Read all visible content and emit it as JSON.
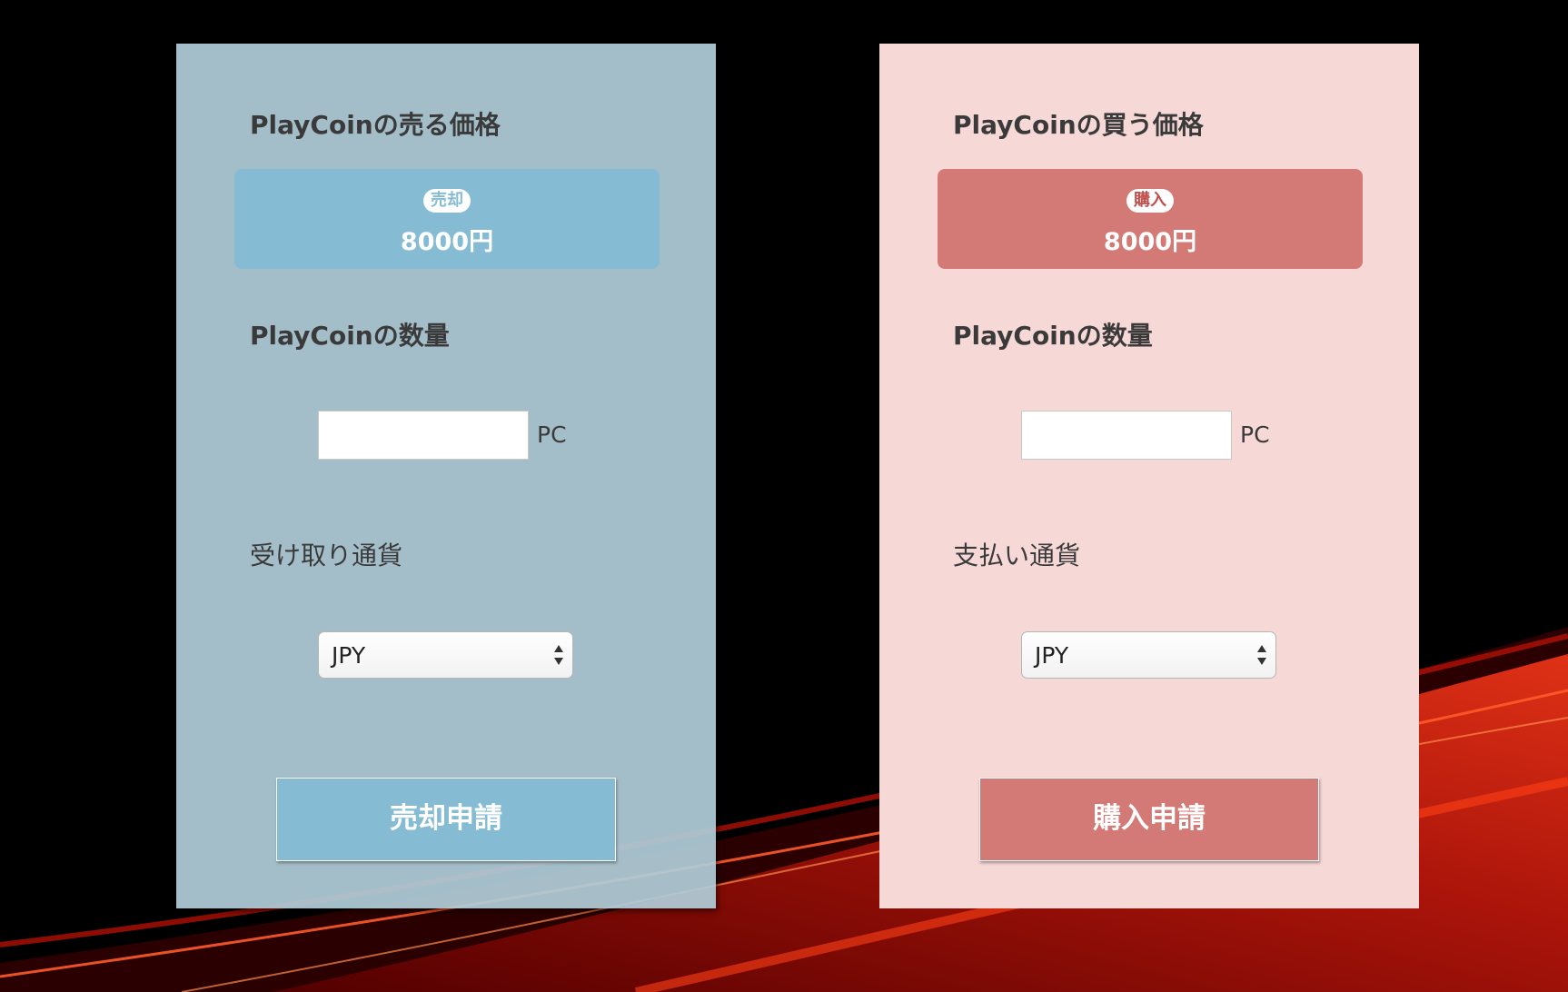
{
  "sell_panel": {
    "title": "PlayCoinの売る価格",
    "badge": "売却",
    "price": "8000円",
    "quantity_label": "PlayCoinの数量",
    "quantity_value": "",
    "unit": "PC",
    "currency_label": "受け取り通貨",
    "currency_selected": "JPY",
    "submit_label": "売却申請"
  },
  "buy_panel": {
    "title": "PlayCoinの買う価格",
    "badge": "購入",
    "price": "8000円",
    "quantity_label": "PlayCoinの数量",
    "quantity_value": "",
    "unit": "PC",
    "currency_label": "支払い通貨",
    "currency_selected": "JPY",
    "submit_label": "購入申請"
  },
  "colors": {
    "sell_accent": "#86bcd3",
    "sell_panel_bg": "#b0ccd8",
    "buy_accent": "#d47a76",
    "buy_panel_bg": "#f6d8d7",
    "page_bg": "#000000"
  }
}
